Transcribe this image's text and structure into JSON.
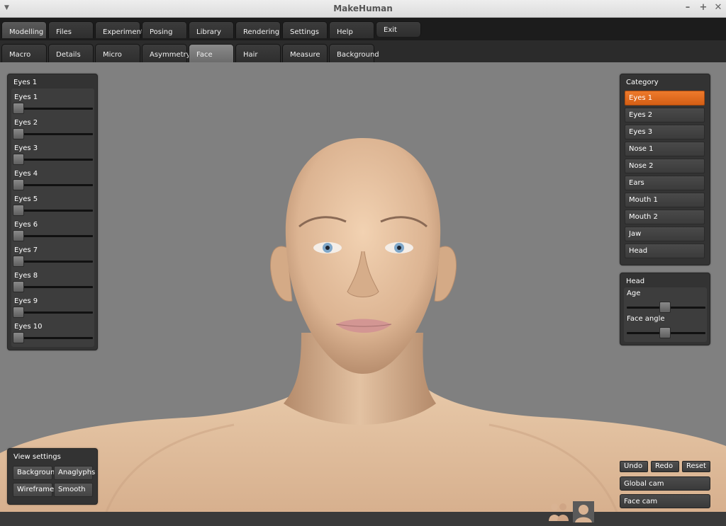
{
  "window": {
    "title": "MakeHuman"
  },
  "main_tabs": [
    {
      "label": "Modelling",
      "active": true
    },
    {
      "label": "Files"
    },
    {
      "label": "Experiments"
    },
    {
      "label": "Posing"
    },
    {
      "label": "Library"
    },
    {
      "label": "Rendering"
    },
    {
      "label": "Settings"
    },
    {
      "label": "Help"
    },
    {
      "label": "Exit"
    }
  ],
  "sub_tabs": [
    {
      "label": "Macro"
    },
    {
      "label": "Details"
    },
    {
      "label": "Micro"
    },
    {
      "label": "Asymmetry"
    },
    {
      "label": "Face",
      "active": true
    },
    {
      "label": "Hair"
    },
    {
      "label": "Measure"
    },
    {
      "label": "Background"
    }
  ],
  "left_panel": {
    "title": "Eyes 1",
    "sliders": [
      {
        "label": "Eyes 1",
        "value": 0
      },
      {
        "label": "Eyes 2",
        "value": 0
      },
      {
        "label": "Eyes 3",
        "value": 0
      },
      {
        "label": "Eyes 4",
        "value": 0
      },
      {
        "label": "Eyes 5",
        "value": 0
      },
      {
        "label": "Eyes 6",
        "value": 0
      },
      {
        "label": "Eyes 7",
        "value": 0
      },
      {
        "label": "Eyes 8",
        "value": 0
      },
      {
        "label": "Eyes 9",
        "value": 0
      },
      {
        "label": "Eyes 10",
        "value": 0
      }
    ]
  },
  "category_panel": {
    "title": "Category",
    "items": [
      {
        "label": "Eyes 1",
        "active": true
      },
      {
        "label": "Eyes 2"
      },
      {
        "label": "Eyes 3"
      },
      {
        "label": "Nose 1"
      },
      {
        "label": "Nose 2"
      },
      {
        "label": "Ears"
      },
      {
        "label": "Mouth 1"
      },
      {
        "label": "Mouth 2"
      },
      {
        "label": "Jaw"
      },
      {
        "label": "Head"
      }
    ]
  },
  "head_panel": {
    "title": "Head",
    "sliders": [
      {
        "label": "Age",
        "value": 0.5
      },
      {
        "label": "Face angle",
        "value": 0.5
      }
    ]
  },
  "view_settings": {
    "title": "View settings",
    "buttons": [
      "Background",
      "Anaglyphs",
      "Wireframe",
      "Smooth"
    ]
  },
  "actions": {
    "undo": "Undo",
    "redo": "Redo",
    "reset": "Reset",
    "global_cam": "Global cam",
    "face_cam": "Face cam"
  },
  "colors": {
    "accent": "#e06a1f",
    "panel": "#333333",
    "viewport": "#808080"
  }
}
